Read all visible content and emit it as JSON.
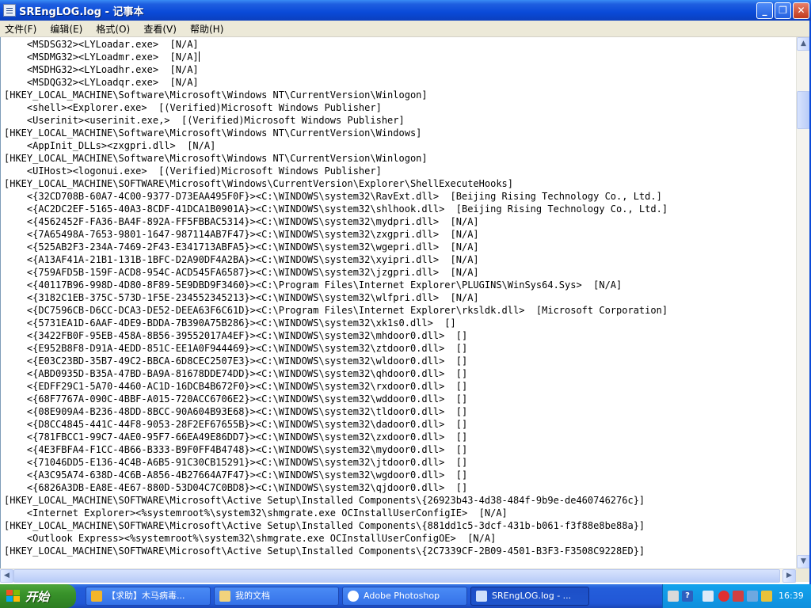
{
  "window": {
    "title": "SREngLOG.log - 记事本",
    "minimize_glyph": "_",
    "maximize_glyph": "❐",
    "close_glyph": "✕"
  },
  "menu": [
    {
      "label": "文件(F)"
    },
    {
      "label": "编辑(E)"
    },
    {
      "label": "格式(O)"
    },
    {
      "label": "查看(V)"
    },
    {
      "label": "帮助(H)"
    }
  ],
  "editor": {
    "lines": [
      "    <MSDSG32><LYLoadar.exe>  [N/A]",
      "    <MSDMG32><LYLoadmr.exe>  [N/A]",
      "    <MSDHG32><LYLoadhr.exe>  [N/A]",
      "    <MSDQG32><LYLoadqr.exe>  [N/A]",
      "[HKEY_LOCAL_MACHINE\\Software\\Microsoft\\Windows NT\\CurrentVersion\\Winlogon]",
      "    <shell><Explorer.exe>  [(Verified)Microsoft Windows Publisher]",
      "    <Userinit><userinit.exe,>  [(Verified)Microsoft Windows Publisher]",
      "[HKEY_LOCAL_MACHINE\\Software\\Microsoft\\Windows NT\\CurrentVersion\\Windows]",
      "    <AppInit_DLLs><zxgpri.dll>  [N/A]",
      "[HKEY_LOCAL_MACHINE\\Software\\Microsoft\\Windows NT\\CurrentVersion\\Winlogon]",
      "    <UIHost><logonui.exe>  [(Verified)Microsoft Windows Publisher]",
      "[HKEY_LOCAL_MACHINE\\SOFTWARE\\Microsoft\\Windows\\CurrentVersion\\Explorer\\ShellExecuteHooks]",
      "    <{32CD708B-60A7-4C00-9377-D73EAA495F0F}><C:\\WINDOWS\\system32\\RavExt.dll>  [Beijing Rising Technology Co., Ltd.]",
      "    <{AC2DC2EF-5165-40A3-8CDF-41DCA1B0901A}><C:\\WINDOWS\\system32\\shlhook.dll>  [Beijing Rising Technology Co., Ltd.]",
      "    <{4562452F-FA36-BA4F-892A-FF5FBBAC5314}><C:\\WINDOWS\\system32\\mydpri.dll>  [N/A]",
      "    <{7A65498A-7653-9801-1647-987114AB7F47}><C:\\WINDOWS\\system32\\zxgpri.dll>  [N/A]",
      "    <{525AB2F3-234A-7469-2F43-E341713ABFA5}><C:\\WINDOWS\\system32\\wgepri.dll>  [N/A]",
      "    <{A13AF41A-21B1-131B-1BFC-D2A90DF4A2BA}><C:\\WINDOWS\\system32\\xyipri.dll>  [N/A]",
      "    <{759AFD5B-159F-ACD8-954C-ACD545FA6587}><C:\\WINDOWS\\system32\\jzgpri.dll>  [N/A]",
      "    <{40117B96-998D-4D80-8F89-5E9DBD9F3460}><C:\\Program Files\\Internet Explorer\\PLUGINS\\WinSys64.Sys>  [N/A]",
      "    <{3182C1EB-375C-573D-1F5E-234552345213}><C:\\WINDOWS\\system32\\wlfpri.dll>  [N/A]",
      "    <{DC7596CB-D6CC-DCA3-DE52-DEEA63F6C61D}><C:\\Program Files\\Internet Explorer\\rksldk.dll>  [Microsoft Corporation]",
      "    <{5731EA1D-6AAF-4DE9-BDDA-7B390A75B286}><C:\\WINDOWS\\system32\\xk1s0.dll>  []",
      "    <{3422FB0F-95EB-458A-8B56-39552017A4EF}><C:\\WINDOWS\\system32\\mhdoor0.dll>  []",
      "    <{E952B8F8-D91A-4EDD-851C-EE1A0F944469}><C:\\WINDOWS\\system32\\ztdoor0.dll>  []",
      "    <{E03C23BD-35B7-49C2-BBCA-6D8CEC2507E3}><C:\\WINDOWS\\system32\\wldoor0.dll>  []",
      "    <{ABD0935D-B35A-47BD-BA9A-81678DDE74DD}><C:\\WINDOWS\\system32\\qhdoor0.dll>  []",
      "    <{EDFF29C1-5A70-4460-AC1D-16DCB4B672F0}><C:\\WINDOWS\\system32\\rxdoor0.dll>  []",
      "    <{68F7767A-090C-4BBF-A015-720ACC6706E2}><C:\\WINDOWS\\system32\\wddoor0.dll>  []",
      "    <{08E909A4-B236-48DD-8BCC-90A604B93E68}><C:\\WINDOWS\\system32\\tldoor0.dll>  []",
      "    <{D8CC4845-441C-44F8-9053-28F2EF67655B}><C:\\WINDOWS\\system32\\dadoor0.dll>  []",
      "    <{781FBCC1-99C7-4AE0-95F7-66EA49E86DD7}><C:\\WINDOWS\\system32\\zxdoor0.dll>  []",
      "    <{4E3FBFA4-F1CC-4B66-B333-B9F0FF4B4748}><C:\\WINDOWS\\system32\\mydoor0.dll>  []",
      "    <{71046DD5-E136-4C4B-A6B5-91C30CB15291}><C:\\WINDOWS\\system32\\jtdoor0.dll>  []",
      "    <{A3C95A74-638D-4C6B-A856-4B27664A7F47}><C:\\WINDOWS\\system32\\wgdoor0.dll>  []",
      "    <{6826A3DB-EA8E-4E67-880D-53D04C7C0BD8}><C:\\WINDOWS\\system32\\qjdoor0.dll>  []",
      "[HKEY_LOCAL_MACHINE\\SOFTWARE\\Microsoft\\Active Setup\\Installed Components\\{26923b43-4d38-484f-9b9e-de460746276c}]",
      "    <Internet Explorer><%systemroot%\\system32\\shmgrate.exe OCInstallUserConfigIE>  [N/A]",
      "[HKEY_LOCAL_MACHINE\\SOFTWARE\\Microsoft\\Active Setup\\Installed Components\\{881dd1c5-3dcf-431b-b061-f3f88e8be88a}]",
      "    <Outlook Express><%systemroot%\\system32\\shmgrate.exe OCInstallUserConfigOE>  [N/A]",
      "[HKEY_LOCAL_MACHINE\\SOFTWARE\\Microsoft\\Active Setup\\Installed Components\\{2C7339CF-2B09-4501-B3F3-F3508C9228ED}]"
    ]
  },
  "scrollbars": {
    "up_glyph": "▲",
    "down_glyph": "▼",
    "left_glyph": "◀",
    "right_glyph": "▶"
  },
  "taskbar": {
    "start_label": "开始",
    "tasks": [
      {
        "label": "【求助】木马病毒...",
        "icon": "browser-icon",
        "color": "#f3b52a"
      },
      {
        "label": "我的文档",
        "icon": "folder-icon",
        "color": "#f2d37c"
      },
      {
        "label": "Adobe Photoshop",
        "icon": "photoshop-icon",
        "color": "#ffffff"
      },
      {
        "label": "SREngLOG.log - ...",
        "icon": "notepad-icon",
        "color": "#cfe0fb"
      }
    ],
    "clock": "16:39"
  },
  "colors": {
    "titlebar": "#0a4ad8",
    "menubar": "#ece9d8",
    "start_button": "#38922a",
    "tray": "#0f8fdd"
  }
}
